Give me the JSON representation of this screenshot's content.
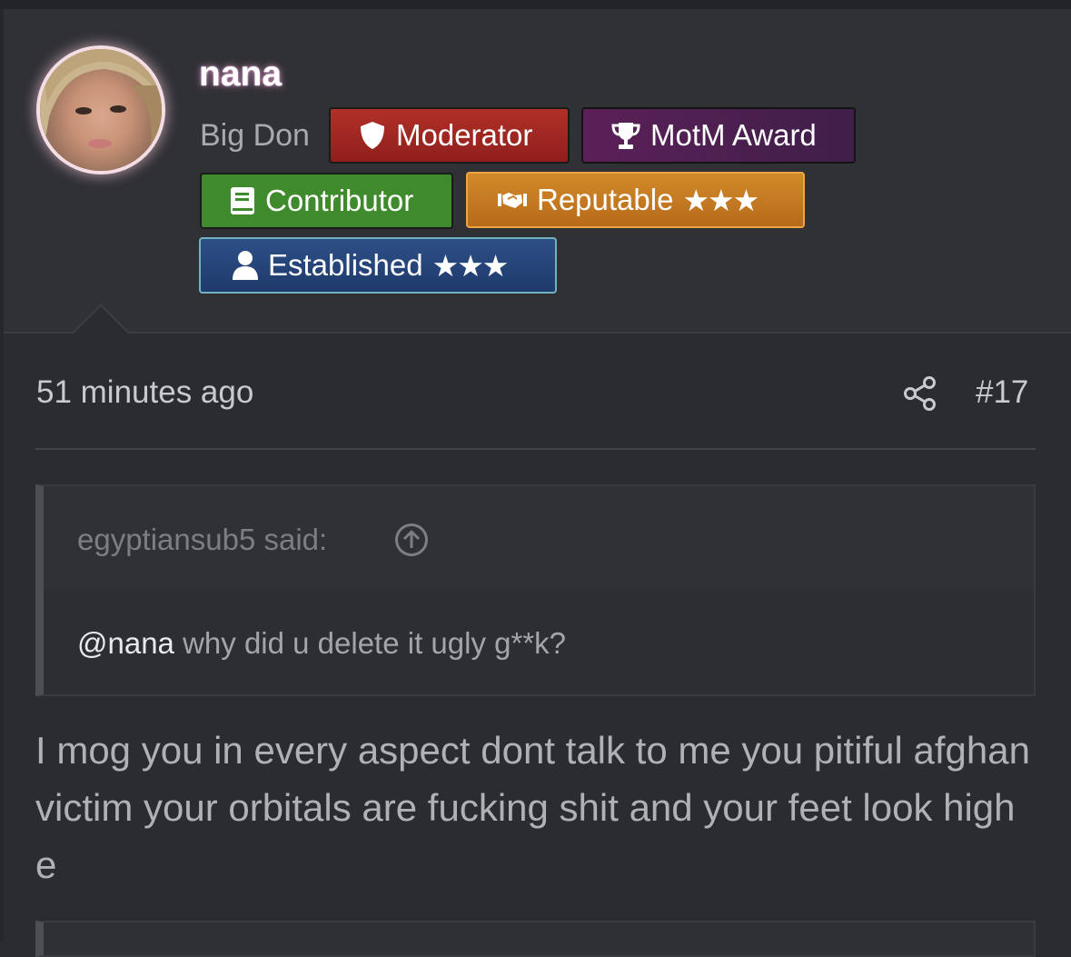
{
  "user": {
    "name": "nana",
    "title": "Big Don",
    "badges": [
      {
        "label": "Moderator",
        "icon": "shield-icon",
        "color": "#a8281f"
      },
      {
        "label": "MotM Award",
        "icon": "trophy-icon",
        "color": "#4f1f52"
      },
      {
        "label": "Contributor",
        "icon": "book-icon",
        "color": "#3f8a2c"
      },
      {
        "label": "Reputable",
        "stars": "★★★",
        "icon": "handshake-icon",
        "color": "#c97d24"
      },
      {
        "label": "Established",
        "stars": "★★★",
        "icon": "user-icon",
        "color": "#25457a"
      }
    ]
  },
  "post": {
    "time": "51 minutes ago",
    "number": "#17",
    "quote": {
      "author": "egyptiansub5 said:",
      "mention": "@nana",
      "text": " why did u delete it ugly g**k?"
    },
    "message": "I mog you in every aspect dont talk to me you pitiful afghan victim your orbitals are fucking shit and your feet look high e"
  }
}
